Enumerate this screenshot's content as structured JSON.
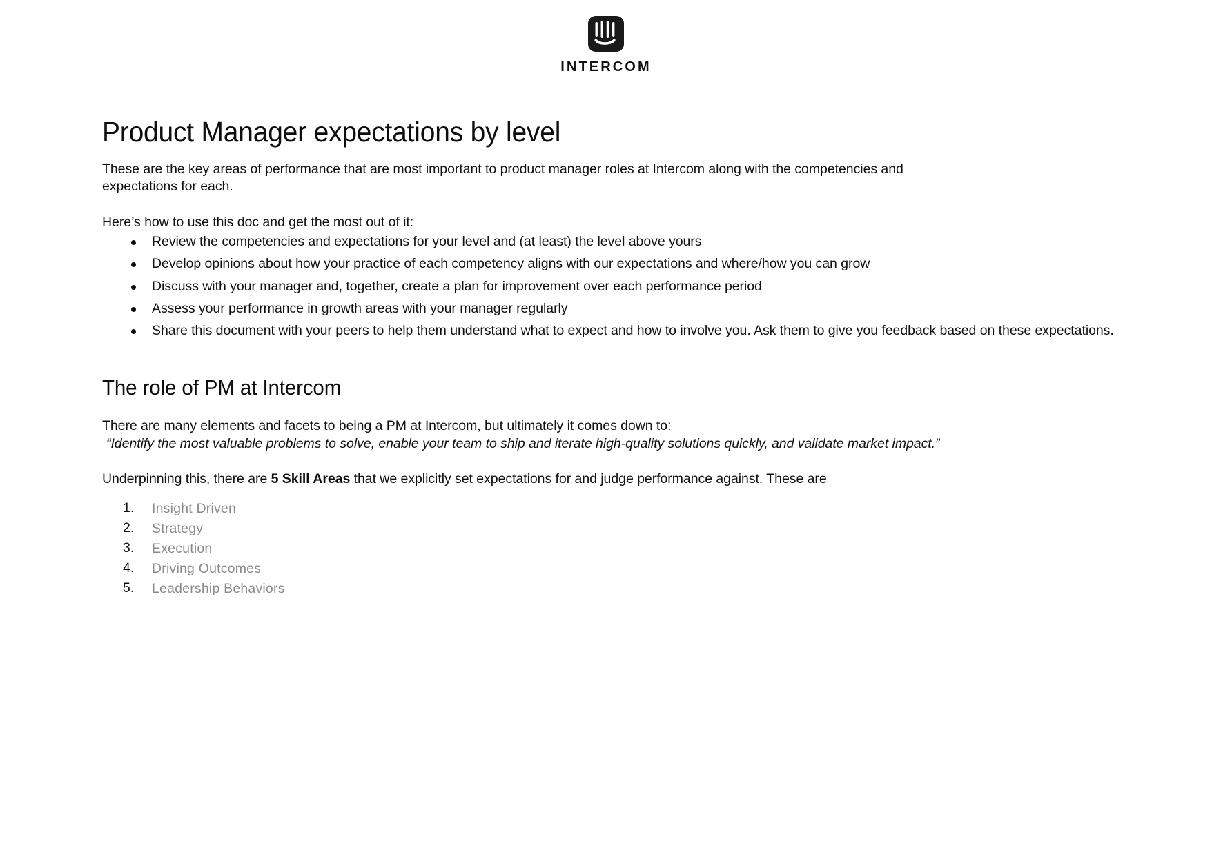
{
  "brand": {
    "logo_icon": "intercom-logo-icon",
    "wordmark": "INTERCOM"
  },
  "document": {
    "title": "Product Manager expectations by level",
    "intro_paragraph": "These are the key areas of performance that are most important to product manager roles at Intercom along with the competencies and expectations for each.",
    "howto_lead_in": "Here’s how to use this doc and get the most out of it:",
    "howto_bullets": [
      "Review the competencies and expectations for your level and (at least) the level above yours",
      "Develop opinions about how your practice of each competency aligns with our expectations and where/how you can grow",
      "Discuss with your manager and, together, create a plan for improvement over each performance period",
      "Assess your performance in growth areas with your manager regularly",
      "Share this document with your peers to help them understand what to expect and how to involve you. Ask them to give you feedback based on these expectations."
    ],
    "section_role": {
      "heading": "The role of PM at Intercom",
      "lead_in": "There are many elements and facets to being a PM at Intercom, but ultimately it comes down to:",
      "quote": "“Identify the most valuable problems to solve, enable your team to ship and iterate high-quality solutions quickly, and validate market impact.”",
      "skill_areas_sentence_before": "Underpinning this, there are ",
      "skill_areas_bold": "5 Skill Areas",
      "skill_areas_sentence_after": " that we explicitly set expectations for and judge performance against. These are",
      "skill_links": [
        "Insight Driven",
        "Strategy",
        "Execution",
        "Driving Outcomes",
        "Leadership Behaviors"
      ]
    }
  },
  "colors": {
    "page_background": "#ffffff",
    "text": "#101010",
    "link": "#8a8a8a",
    "logo": "#1a1a1a"
  }
}
